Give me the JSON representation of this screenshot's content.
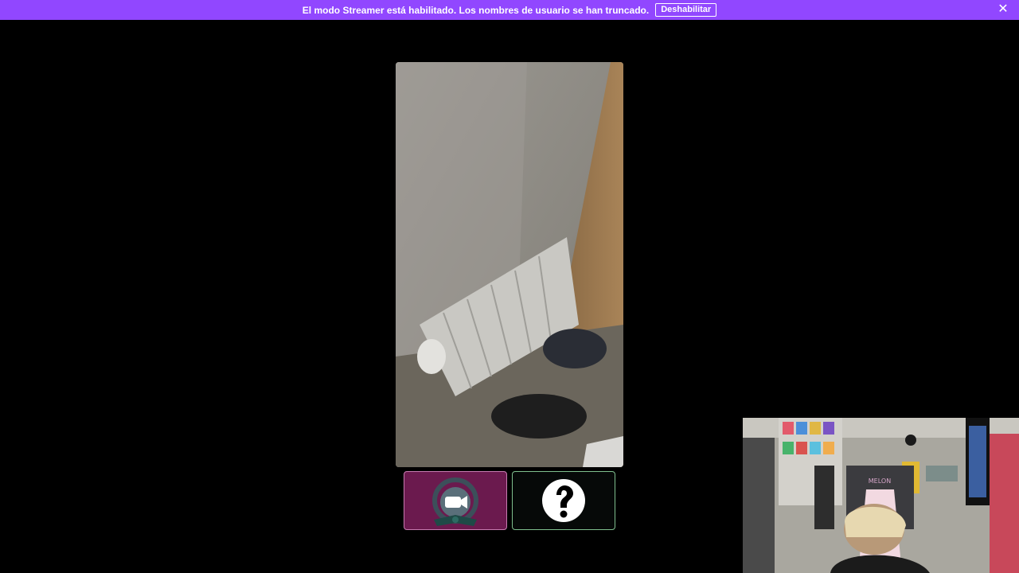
{
  "streamer_banner": {
    "message": "El modo Streamer está habilitado. Los nombres de usuario se han truncado.",
    "disable_label": "Deshabilitar",
    "close_icon": "close-icon",
    "background": "#9147ff"
  },
  "main_video": {
    "content": "radiator-camera-feed"
  },
  "reward_cards": [
    {
      "icon": "video-camera-icon",
      "accent": "#6b1a4e"
    },
    {
      "icon": "question-mark-icon",
      "accent": "#060908"
    }
  ],
  "webcam_overlay": {
    "chair_brand": "MELON"
  }
}
